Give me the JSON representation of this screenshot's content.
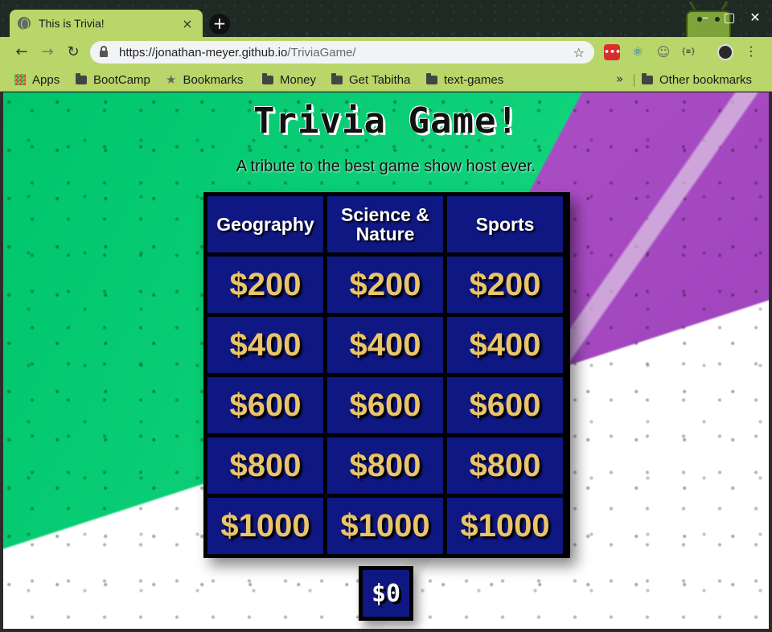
{
  "browser": {
    "tab_title": "This is Trivia!",
    "tab_close": "×",
    "new_tab": "+",
    "url_host": "https://jonathan-meyer.github.io",
    "url_path": "/TriviaGame/",
    "window": {
      "minimize": "–",
      "maximize": "▢",
      "close": "✕"
    },
    "nav": {
      "back": "←",
      "forward": "→",
      "reload": "↻"
    },
    "extensions": {
      "ext1": "•••",
      "ext2": "⚛",
      "ext3": "☺",
      "ext4": "{≡}"
    },
    "menu": "⋮"
  },
  "bookmarks": {
    "items": [
      "Apps",
      "BootCamp",
      "Bookmarks",
      "Money",
      "Get Tabitha",
      "text-games"
    ],
    "overflow": "»",
    "other": "Other bookmarks"
  },
  "page": {
    "title": "Trivia Game!",
    "tagline": "A tribute to the best game show host ever.",
    "categories": [
      "Geography",
      "Science & Nature",
      "Sports"
    ],
    "values": [
      "$200",
      "$400",
      "$600",
      "$800",
      "$1000"
    ],
    "score": "$0"
  },
  "colors": {
    "chrome": "#b9d66a",
    "board_cell": "#0f1782",
    "value_text": "#e9c46a",
    "green_bg": "#00c56b",
    "purple_bg": "#b658cf"
  }
}
